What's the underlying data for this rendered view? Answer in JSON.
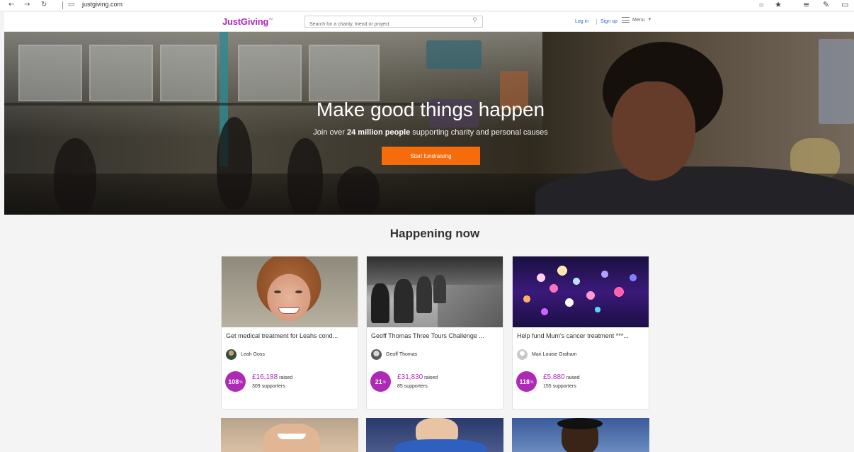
{
  "browser": {
    "back_icon": "back-arrow-icon",
    "forward_icon": "forward-arrow-icon",
    "refresh_icon": "refresh-icon",
    "url": "justgiving.com"
  },
  "header": {
    "logo": "JustGiving",
    "search_placeholder": "Search for a charity, friend or project",
    "search_icon": "search-icon",
    "login_label": "Log in",
    "signup_label": "Sign up",
    "menu_label": "Menu",
    "menu_icon": "hamburger-icon",
    "brand_color": "#ad29b6",
    "link_color": "#2a66b8"
  },
  "hero": {
    "title": "Make good things happen",
    "subtitle_prefix": "Join over ",
    "subtitle_bold": "24 million people",
    "subtitle_suffix": " supporting charity and personal causes",
    "cta_label": "Start fundraising",
    "cta_color": "#f66c0a"
  },
  "happening": {
    "title": "Happening now",
    "cards": [
      {
        "title": "Get medical treatment for Leahs cond...",
        "owner": "Leah Goss",
        "percent": "108",
        "percent_unit": "%",
        "amount": "£16,188",
        "raised_label": " raised",
        "supporters": "309 supporters"
      },
      {
        "title": "Geoff Thomas Three Tours Challenge ...",
        "owner": "Geoff Thomas",
        "percent": "21",
        "percent_unit": "%",
        "amount": "£31,830",
        "raised_label": " raised",
        "supporters": "85 supporters"
      },
      {
        "title": "Help fund Mum's cancer treatment ***...",
        "owner": "Mari Louise Graham",
        "percent": "118",
        "percent_unit": "%",
        "amount": "£5,880",
        "raised_label": " raised",
        "supporters": "155 supporters"
      }
    ]
  }
}
